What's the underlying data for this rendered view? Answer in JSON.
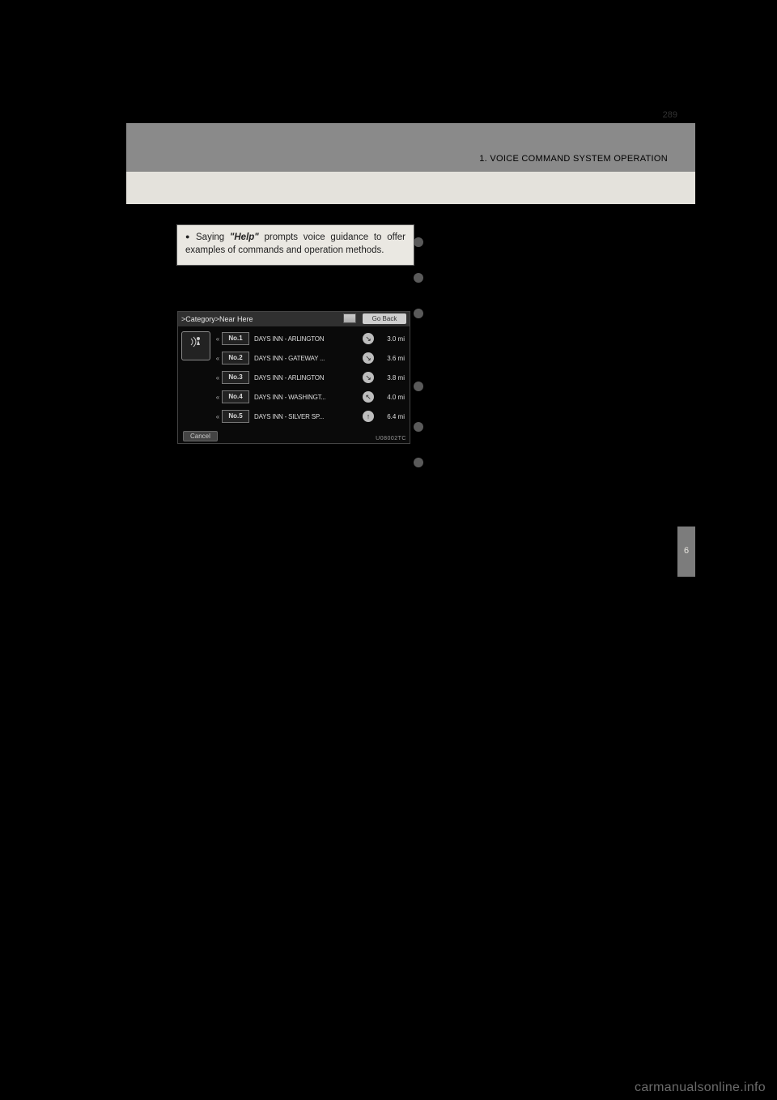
{
  "header": {
    "section_title": "1. VOICE COMMAND SYSTEM OPERATION",
    "page_number": "289"
  },
  "help_box": {
    "lead": "Saying ",
    "bold": "\"Help\"",
    "rest": " prompts voice guidance to offer examples of commands and operation methods."
  },
  "screenshot": {
    "title": ">Category>Near Here",
    "go_back": "Go Back",
    "cancel": "Cancel",
    "image_code": "U08002TC",
    "rows": [
      {
        "num": "No.1",
        "name": "DAYS INN - ARLINGTON",
        "dir": "↘",
        "dist": "3.0 mi"
      },
      {
        "num": "No.2",
        "name": "DAYS INN - GATEWAY ...",
        "dir": "↘",
        "dist": "3.6 mi"
      },
      {
        "num": "No.3",
        "name": "DAYS INN - ARLINGTON",
        "dir": "↘",
        "dist": "3.8 mi"
      },
      {
        "num": "No.4",
        "name": "DAYS INN - WASHINGT...",
        "dir": "↖",
        "dist": "4.0 mi"
      },
      {
        "num": "No.5",
        "name": "DAYS INN - SILVER SP...",
        "dir": "↑",
        "dist": "6.4 mi"
      }
    ]
  },
  "side_tab": {
    "label": "6"
  },
  "watermark": "carmanualsonline.info"
}
